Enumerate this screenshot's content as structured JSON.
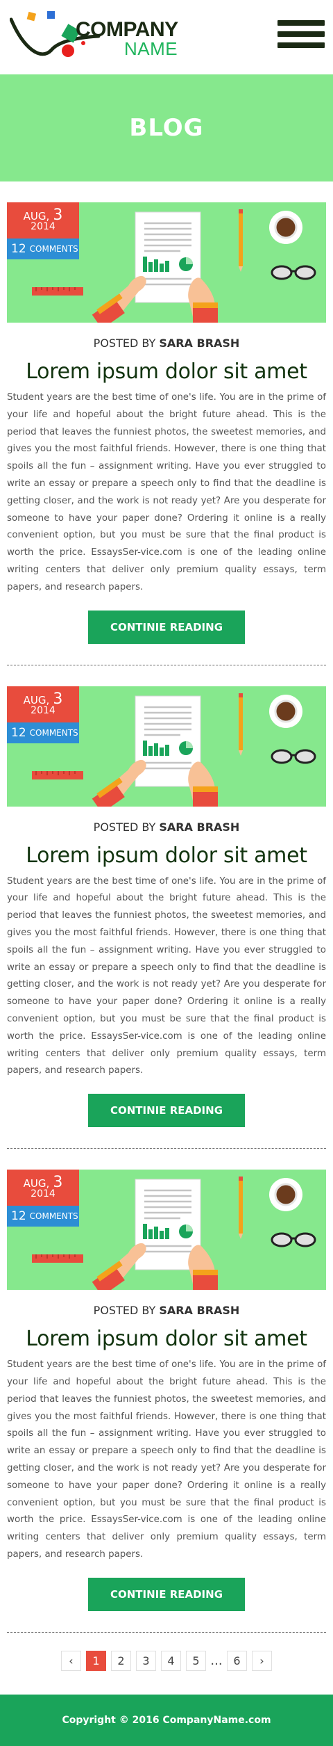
{
  "header": {
    "logo_line1": "COMPANY",
    "logo_line2": "NAME",
    "menu_icon": "hamburger-icon"
  },
  "banner": {
    "title": "BLOG"
  },
  "posts": [
    {
      "month": "AUG,",
      "day": "3",
      "year": "2014",
      "comments_count": "12",
      "comments_label": "COMMENTS",
      "posted_by_prefix": "POSTED BY",
      "author": "SARA BRASH",
      "title": "Lorem ipsum dolor sit amet",
      "body": "Student years are the best time of one's life. You are in the prime of your life and hopeful about the bright future ahead. This is the period that leaves the funniest photos, the sweetest memories, and gives you the most faithful friends. However, there is one thing that spoils all the fun – assignment writing. Have you ever struggled to write an essay or prepare a speech only to find that the deadline is getting closer, and the work is not ready yet? Are you desperate for someone to have your paper done? Ordering it online is a really convenient option, but you must be sure that the final product is worth the price. EssaysSer-vice.com is one of the leading online writing centers that deliver only premium quality essays, term papers, and research papers.",
      "button": "CONTINIE READING"
    },
    {
      "month": "AUG,",
      "day": "3",
      "year": "2014",
      "comments_count": "12",
      "comments_label": "COMMENTS",
      "posted_by_prefix": "POSTED BY",
      "author": "SARA BRASH",
      "title": "Lorem ipsum dolor sit amet",
      "body": "Student years are the best time of one's life. You are in the prime of your life and hopeful about the bright future ahead. This is the period that leaves the funniest photos, the sweetest memories, and gives you the most faithful friends. However, there is one thing that spoils all the fun – assignment writing. Have you ever struggled to write an essay or prepare a speech only to find that the deadline is getting closer, and the work is not ready yet? Are you desperate for someone to have your paper done? Ordering it online is a really convenient option, but you must be sure that the final product is worth the price. EssaysSer-vice.com is one of the leading online writing centers that deliver only premium quality essays, term papers, and research papers.",
      "button": "CONTINIE READING"
    },
    {
      "month": "AUG,",
      "day": "3",
      "year": "2014",
      "comments_count": "12",
      "comments_label": "COMMENTS",
      "posted_by_prefix": "POSTED BY",
      "author": "SARA BRASH",
      "title": "Lorem ipsum dolor sit amet",
      "body": "Student years are the best time of one's life. You are in the prime of your life and hopeful about the bright future ahead. This is the period that leaves the funniest photos, the sweetest memories, and gives you the most faithful friends. However, there is one thing that spoils all the fun – assignment writing. Have you ever struggled to write an essay or prepare a speech only to find that the deadline is getting closer, and the work is not ready yet? Are you desperate for someone to have your paper done? Ordering it online is a really convenient option, but you must be sure that the final product is worth the price. EssaysSer-vice.com is one of the leading online writing centers that deliver only premium quality essays, term papers, and research papers.",
      "button": "CONTINIE READING"
    }
  ],
  "pagination": {
    "prev": "‹",
    "pages": [
      "1",
      "2",
      "3",
      "4",
      "5"
    ],
    "ellipsis": "...",
    "last": "6",
    "next": "›",
    "active": "1"
  },
  "footer": {
    "copyright": "Copyright © 2016 CompanyName.com"
  },
  "colors": {
    "accent_green": "#1aa45a",
    "light_green": "#86e88d",
    "date_red": "#e84c3d",
    "comments_blue": "#2d8ed5"
  }
}
